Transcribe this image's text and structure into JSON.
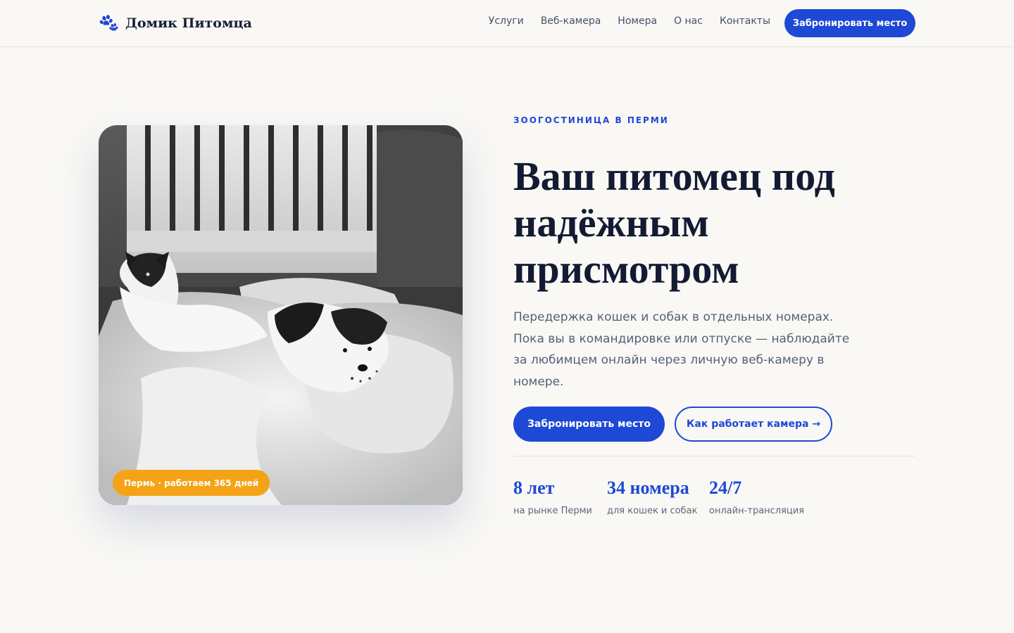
{
  "header": {
    "logo_text": "Домик Питомца",
    "nav": [
      "Услуги",
      "Веб-камера",
      "Номера",
      "О нас",
      "Контакты"
    ],
    "cta_label": "Забронировать место"
  },
  "hero": {
    "image_badge": "Пермь · работаем 365 дней",
    "eyebrow": "ЗООГОСТИНИЦА В ПЕРМИ",
    "headline": "Ваш питомец под надёжным присмотром",
    "lead": "Передержка кошек и собак в отдельных номерах. Пока вы в командировке или отпуске — наблюдайте за любимцем онлайн через личную веб-камеру в номере.",
    "primary_button": "Забронировать место",
    "secondary_button": "Как работает камера →",
    "stats": [
      {
        "value": "8 лет",
        "label": "на рынке Перми"
      },
      {
        "value": "34 номера",
        "label": "для кошек и собак"
      },
      {
        "value": "24/7",
        "label": "онлайн-трансляция"
      }
    ]
  },
  "colors": {
    "accent": "#1e48d6",
    "badge": "#f5a316",
    "background": "#f9f8f5",
    "heading": "#131b33"
  },
  "icons": {
    "logo": "paw-icon"
  }
}
